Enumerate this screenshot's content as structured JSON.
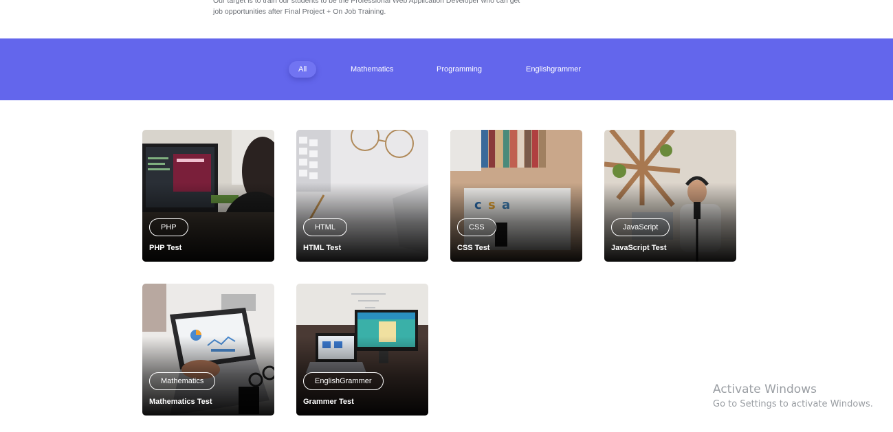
{
  "intro": {
    "line1": "Our target is to train our students to be the Professional Web Application Developer who can get",
    "line2": "job opportunities after Final Project + On Job Training."
  },
  "filters": {
    "accent_color": "#6366ec",
    "items": [
      {
        "label": "All",
        "active": true
      },
      {
        "label": "Mathematics",
        "active": false
      },
      {
        "label": "Programming",
        "active": false
      },
      {
        "label": "Englishgrammer",
        "active": false
      }
    ]
  },
  "cards": [
    {
      "tag": "PHP",
      "title": "PHP Test",
      "image": "desk-monitor-photo"
    },
    {
      "tag": "HTML",
      "title": "HTML Test",
      "image": "keyboard-glasses-photo"
    },
    {
      "tag": "CSS",
      "title": "CSS Test",
      "image": "css-book-photo"
    },
    {
      "tag": "JavaScript",
      "title": "JavaScript Test",
      "image": "podcast-person-photo"
    },
    {
      "tag": "Mathematics",
      "title": "Mathematics Test",
      "image": "laptop-charts-photo"
    },
    {
      "tag": "EnglishGrammer",
      "title": "Grammer Test",
      "image": "laptop-monitor-photo"
    }
  ],
  "watermark": {
    "title": "Activate Windows",
    "subtitle": "Go to Settings to activate Windows."
  }
}
